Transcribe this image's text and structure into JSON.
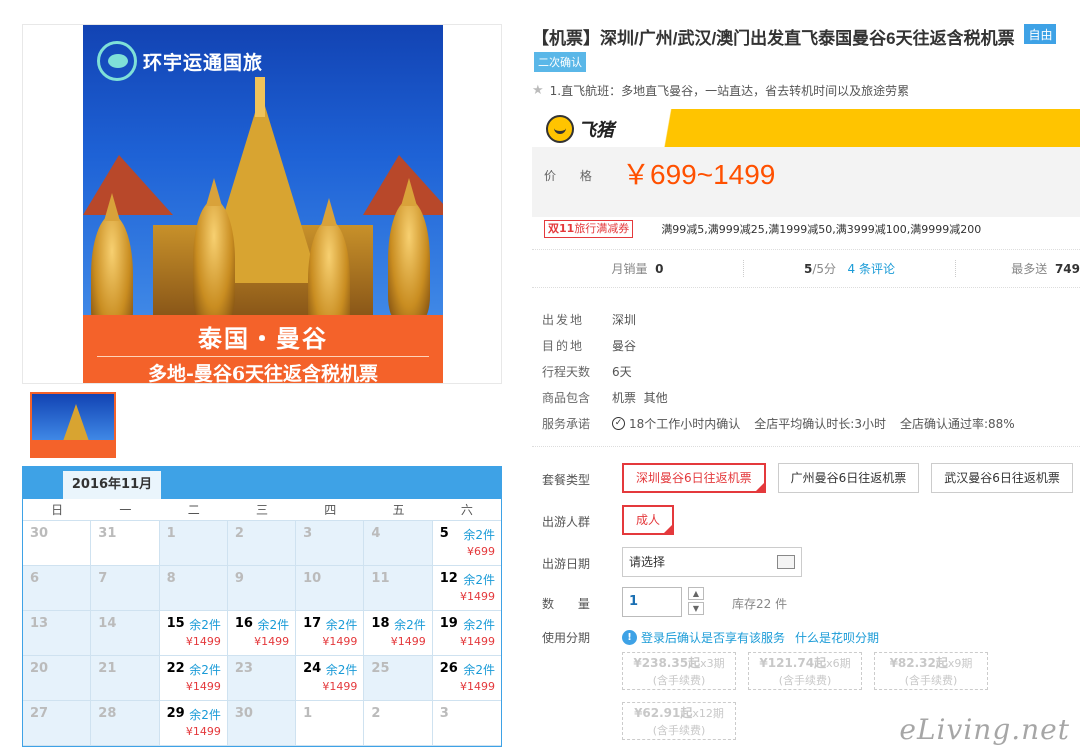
{
  "poster": {
    "logo_text": "环宇运通国旅",
    "title": "泰国・曼谷",
    "subtitle": "多地-曼谷6天往返含税机票"
  },
  "calendar": {
    "month": "2016年11月",
    "weekdays": [
      "日",
      "一",
      "二",
      "三",
      "四",
      "五",
      "六"
    ],
    "cells": [
      {
        "day": "30",
        "out": true
      },
      {
        "day": "31",
        "out": true
      },
      {
        "day": "1"
      },
      {
        "day": "2"
      },
      {
        "day": "3"
      },
      {
        "day": "4"
      },
      {
        "day": "5",
        "stock": "余2件",
        "price": "¥699"
      },
      {
        "day": "6"
      },
      {
        "day": "7"
      },
      {
        "day": "8"
      },
      {
        "day": "9"
      },
      {
        "day": "10"
      },
      {
        "day": "11"
      },
      {
        "day": "12",
        "stock": "余2件",
        "price": "¥1499"
      },
      {
        "day": "13"
      },
      {
        "day": "14"
      },
      {
        "day": "15",
        "stock": "余2件",
        "price": "¥1499"
      },
      {
        "day": "16",
        "stock": "余2件",
        "price": "¥1499"
      },
      {
        "day": "17",
        "stock": "余2件",
        "price": "¥1499"
      },
      {
        "day": "18",
        "stock": "余2件",
        "price": "¥1499"
      },
      {
        "day": "19",
        "stock": "余2件",
        "price": "¥1499"
      },
      {
        "day": "20"
      },
      {
        "day": "21"
      },
      {
        "day": "22",
        "stock": "余2件",
        "price": "¥1499"
      },
      {
        "day": "23"
      },
      {
        "day": "24",
        "stock": "余2件",
        "price": "¥1499"
      },
      {
        "day": "25"
      },
      {
        "day": "26",
        "stock": "余2件",
        "price": "¥1499"
      },
      {
        "day": "27"
      },
      {
        "day": "28"
      },
      {
        "day": "29",
        "stock": "余2件",
        "price": "¥1499"
      },
      {
        "day": "30"
      },
      {
        "day": "1",
        "out": true
      },
      {
        "day": "2",
        "out": true
      },
      {
        "day": "3",
        "out": true
      }
    ]
  },
  "product": {
    "title": "【机票】深圳/广州/武汉/澳门出发直飞泰国曼谷6天往返含税机票",
    "tag_self": "自由",
    "tag_confirm": "二次确认",
    "highlight": "1.直飞航班：多地直飞曼谷，一站直达，省去转机时间以及旅途劳累"
  },
  "price_panel": {
    "brand": "飞猪",
    "label": "价 格",
    "value": "￥699~1499"
  },
  "promo": {
    "badge_prefix": "双11",
    "badge_text": "旅行满减券",
    "text": "满99减5,满999减25,满1999减50,满3999减100,满9999减200"
  },
  "stats": {
    "sales_label": "月销量",
    "sales_value": "0",
    "rating_value": "5",
    "rating_unit": "/5分",
    "reviews_link": "4 条评论",
    "points_label": "最多送",
    "points_value": "749"
  },
  "info": [
    {
      "label": "出发地",
      "value": "深圳"
    },
    {
      "label": "目的地",
      "value": "曼谷"
    },
    {
      "label": "行程天数",
      "value": "6天"
    },
    {
      "label": "商品包含",
      "value": "机票  其他"
    }
  ],
  "service": {
    "label": "服务承诺",
    "items": [
      "18个工作小时内确认",
      "全店平均确认时长:3小时",
      "全店确认通过率:88%"
    ]
  },
  "package": {
    "label": "套餐类型",
    "options": [
      "深圳曼谷6日往返机票",
      "广州曼谷6日往返机票",
      "武汉曼谷6日往返机票"
    ]
  },
  "group": {
    "label": "出游人群",
    "option": "成人"
  },
  "date": {
    "label": "出游日期",
    "placeholder": "请选择"
  },
  "quantity": {
    "label": "数 量",
    "value": "1",
    "stock": "库存22 件"
  },
  "installment": {
    "label": "使用分期",
    "note": "登录后确认是否享有该服务",
    "link": "什么是花呗分期",
    "periods": [
      {
        "amount": "¥238.35起",
        "term": "x3期",
        "fee": "(含手续费)"
      },
      {
        "amount": "¥121.74起",
        "term": "x6期",
        "fee": "(含手续费)"
      },
      {
        "amount": "¥82.32起",
        "term": "x9期",
        "fee": "(含手续费)"
      },
      {
        "amount": "¥62.91起",
        "term": "x12期",
        "fee": "(含手续费)"
      }
    ]
  },
  "watermark": "eLiving.net"
}
